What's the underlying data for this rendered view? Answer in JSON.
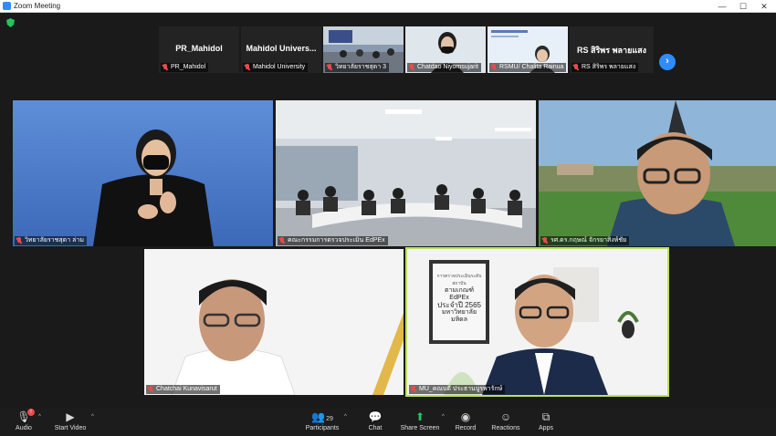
{
  "window": {
    "title": "Zoom Meeting",
    "minimize": "—",
    "maximize": "☐",
    "close": "✕"
  },
  "gallery_strip": [
    {
      "display": "PR_Mahidol",
      "name": "PR_Mahidol"
    },
    {
      "display": "Mahidol Univers...",
      "name": "Mahidol University"
    },
    {
      "display": "",
      "name": "วิทยาลัยราชสุดา 3"
    },
    {
      "display": "",
      "name": "Chatdao Niyomsujarit"
    },
    {
      "display": "",
      "name": "RSMU/ Chalita Rainua"
    },
    {
      "display": "RS สิริพร พลายแสง",
      "name": "RS สิริพร พลายแสง"
    }
  ],
  "main_tiles": [
    {
      "name": "วิทยาลัยราชสุดา ล่าม"
    },
    {
      "name": "คณะกรรมการตรวจประเมิน EdPEx"
    },
    {
      "name": "รศ.ดร.กฤษณ์ จักรยาสิงห์ชัย"
    },
    {
      "name": "Chatchai Kunavisarut"
    },
    {
      "name": "MU_คณบดี ประธานบูรพารักษ์"
    }
  ],
  "poster": {
    "line1": "การตรวจประเมินระดับสถาบัน",
    "line2": "ตามเกณฑ์ EdPEx",
    "line3": "ประจำปี 2565",
    "line4": "มหาวิทยาลัยมหิดล"
  },
  "toolbar": {
    "audio": "Audio",
    "audio_badge": "!",
    "start_video": "Start Video",
    "participants": "Participants",
    "participants_count": "29",
    "chat": "Chat",
    "share_screen": "Share Screen",
    "record": "Record",
    "reactions": "Reactions",
    "apps": "Apps"
  },
  "colors": {
    "accent": "#2d8cff",
    "active_speaker": "#b9e35a",
    "share": "#23c55e",
    "muted": "#e84b4b"
  }
}
